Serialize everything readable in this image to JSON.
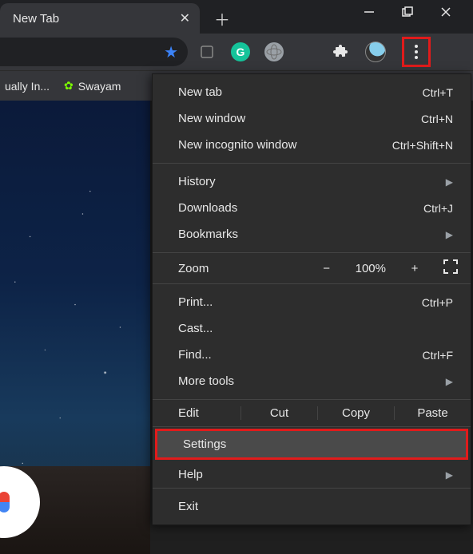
{
  "window": {
    "tab_title": "New Tab"
  },
  "bookmarks": {
    "item1": "ually In...",
    "item2": "Swayam"
  },
  "menu": {
    "new_tab": {
      "label": "New tab",
      "shortcut": "Ctrl+T"
    },
    "new_window": {
      "label": "New window",
      "shortcut": "Ctrl+N"
    },
    "incognito": {
      "label": "New incognito window",
      "shortcut": "Ctrl+Shift+N"
    },
    "history": {
      "label": "History"
    },
    "downloads": {
      "label": "Downloads",
      "shortcut": "Ctrl+J"
    },
    "bookmarks": {
      "label": "Bookmarks"
    },
    "zoom": {
      "label": "Zoom",
      "value": "100%"
    },
    "print": {
      "label": "Print...",
      "shortcut": "Ctrl+P"
    },
    "cast": {
      "label": "Cast..."
    },
    "find": {
      "label": "Find...",
      "shortcut": "Ctrl+F"
    },
    "more_tools": {
      "label": "More tools"
    },
    "edit": {
      "label": "Edit",
      "cut": "Cut",
      "copy": "Copy",
      "paste": "Paste"
    },
    "settings": {
      "label": "Settings"
    },
    "help": {
      "label": "Help"
    },
    "exit": {
      "label": "Exit"
    }
  }
}
